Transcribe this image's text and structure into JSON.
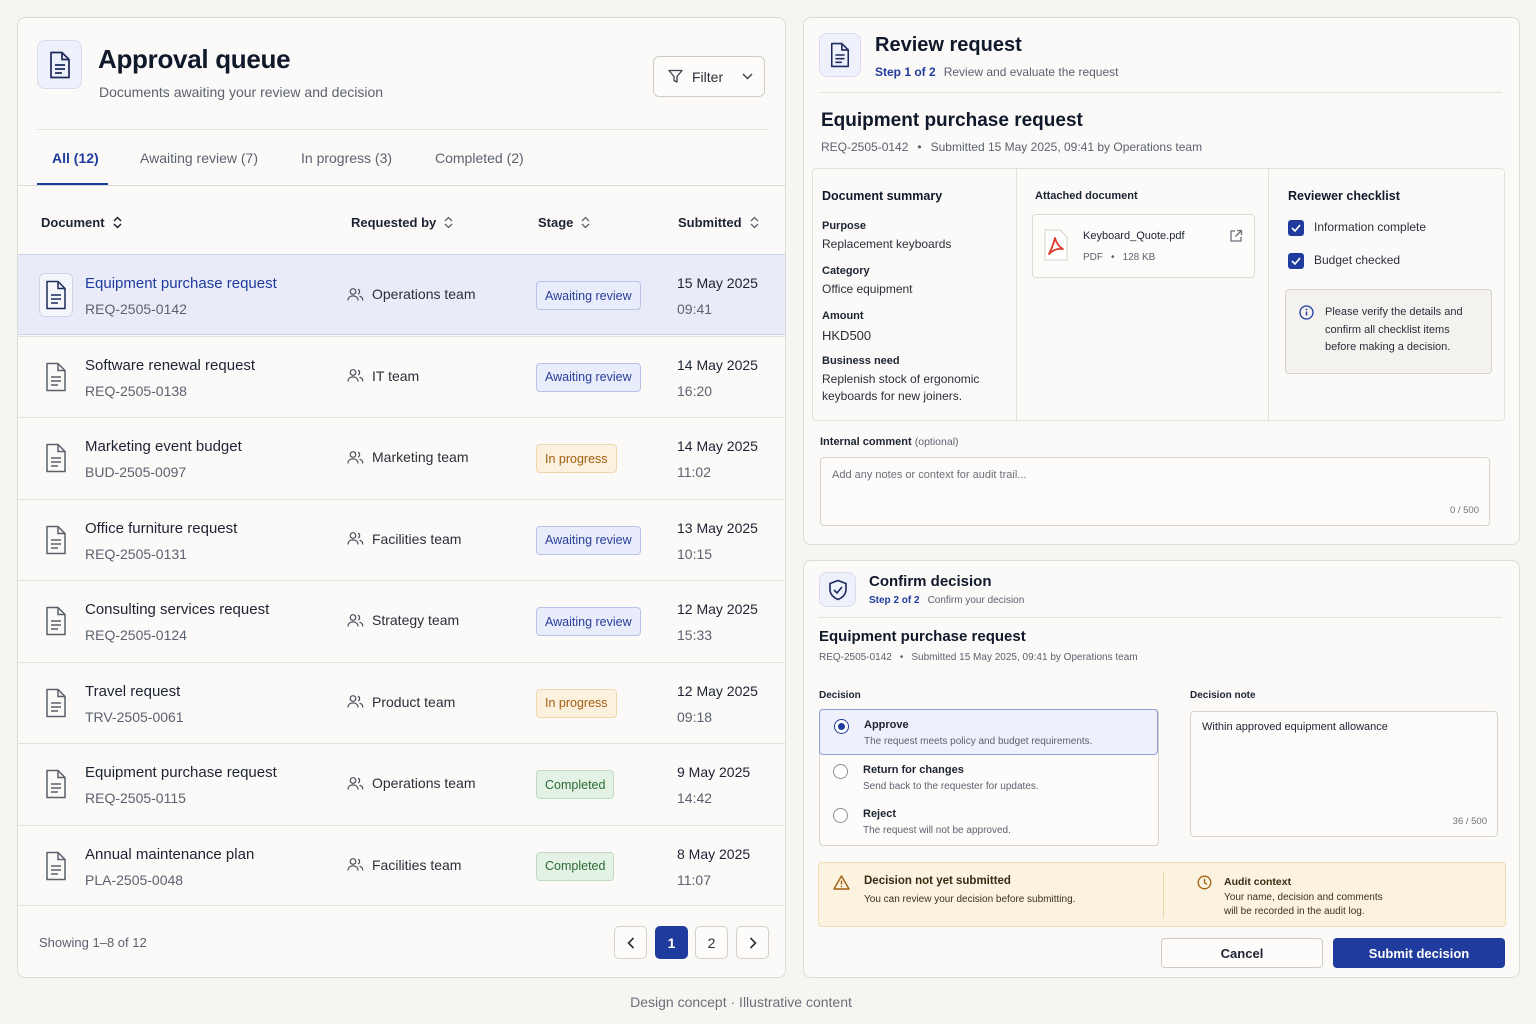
{
  "queue": {
    "title": "Approval queue",
    "subtitle": "Documents awaiting your review and decision",
    "filter_label": "Filter",
    "tabs": [
      {
        "label": "All (12)"
      },
      {
        "label": "Awaiting review (7)"
      },
      {
        "label": "In progress (3)"
      },
      {
        "label": "Completed (2)"
      }
    ],
    "columns": {
      "document": "Document",
      "requested_by": "Requested by",
      "stage": "Stage",
      "submitted": "Submitted"
    },
    "rows": [
      {
        "name": "Equipment purchase request",
        "id": "REQ-2505-0142",
        "team": "Operations team",
        "stage": "Awaiting review",
        "date": "15 May 2025",
        "time": "09:41"
      },
      {
        "name": "Software renewal request",
        "id": "REQ-2505-0138",
        "team": "IT team",
        "stage": "Awaiting review",
        "date": "14 May 2025",
        "time": "16:20"
      },
      {
        "name": "Marketing event budget",
        "id": "BUD-2505-0097",
        "team": "Marketing team",
        "stage": "In progress",
        "date": "14 May 2025",
        "time": "11:02"
      },
      {
        "name": "Office furniture request",
        "id": "REQ-2505-0131",
        "team": "Facilities team",
        "stage": "Awaiting review",
        "date": "13 May 2025",
        "time": "10:15"
      },
      {
        "name": "Consulting services request",
        "id": "REQ-2505-0124",
        "team": "Strategy team",
        "stage": "Awaiting review",
        "date": "12 May 2025",
        "time": "15:33"
      },
      {
        "name": "Travel request",
        "id": "TRV-2505-0061",
        "team": "Product team",
        "stage": "In progress",
        "date": "12 May 2025",
        "time": "09:18"
      },
      {
        "name": "Equipment purchase request",
        "id": "REQ-2505-0115",
        "team": "Operations team",
        "stage": "Completed",
        "date": "9 May 2025",
        "time": "14:42"
      },
      {
        "name": "Annual maintenance plan",
        "id": "PLA-2505-0048",
        "team": "Facilities team",
        "stage": "Completed",
        "date": "8 May 2025",
        "time": "11:07"
      }
    ],
    "showing": "Showing 1–8 of 12",
    "pages": [
      "1",
      "2"
    ],
    "current_page": "1"
  },
  "review": {
    "title": "Review request",
    "step": "Step 1 of 2",
    "step_desc": "Review and evaluate the request",
    "request_title": "Equipment purchase request",
    "request_id": "REQ-2505-0142",
    "bullet": "•",
    "submitted_meta": "Submitted 15 May 2025, 09:41 by Operations team",
    "summary": {
      "heading": "Document summary",
      "purpose_label": "Purpose",
      "purpose": "Replacement keyboards",
      "category_label": "Category",
      "category": "Office equipment",
      "amount_label": "Amount",
      "amount": "HKD500",
      "need_label": "Business need",
      "need_line1": "Replenish stock of ergonomic",
      "need_line2": "keyboards for new joiners."
    },
    "attachment": {
      "heading": "Attached document",
      "filename": "Keyboard_Quote.pdf",
      "type": "PDF",
      "size": "128 KB"
    },
    "checklist": {
      "heading": "Reviewer checklist",
      "items": [
        {
          "label": "Information complete",
          "checked": true
        },
        {
          "label": "Budget checked",
          "checked": true
        }
      ],
      "note_line1": "Please verify the details and",
      "note_line2": "confirm all checklist items",
      "note_line3": "before making a decision."
    },
    "comment": {
      "label": "Internal comment",
      "optional": "(optional)",
      "placeholder": "Add any notes or context for audit trail...",
      "counter": "0 / 500"
    }
  },
  "decision": {
    "title": "Confirm decision",
    "step": "Step 2 of 2",
    "step_desc": "Confirm your decision",
    "request_title": "Equipment purchase request",
    "request_id": "REQ-2505-0142",
    "bullet": "•",
    "submitted_meta": "Submitted 15 May 2025, 09:41 by Operations team",
    "decision_label": "Decision",
    "options": [
      {
        "label": "Approve",
        "desc": "The request meets policy and budget requirements.",
        "selected": true
      },
      {
        "label": "Return for changes",
        "desc": "Send back to the requester for updates.",
        "selected": false
      },
      {
        "label": "Reject",
        "desc": "The request will not be approved.",
        "selected": false
      }
    ],
    "note_label": "Decision note",
    "note_value": "Within approved equipment allowance",
    "note_counter": "36 / 500",
    "warning_title": "Decision not yet submitted",
    "warning_desc": "You can review your decision before submitting.",
    "audit_title": "Audit context",
    "audit_line1": "Your name, decision and comments",
    "audit_line2": "will be recorded in the audit log.",
    "cancel_label": "Cancel",
    "submit_label": "Submit decision"
  },
  "footer": "Design concept · Illustrative content",
  "colors": {
    "accent": "#1f3b9e",
    "awaiting": "#2a3f9a",
    "in_progress": "#a35f10",
    "completed": "#2b6b35",
    "pdf": "#d83a2e"
  }
}
